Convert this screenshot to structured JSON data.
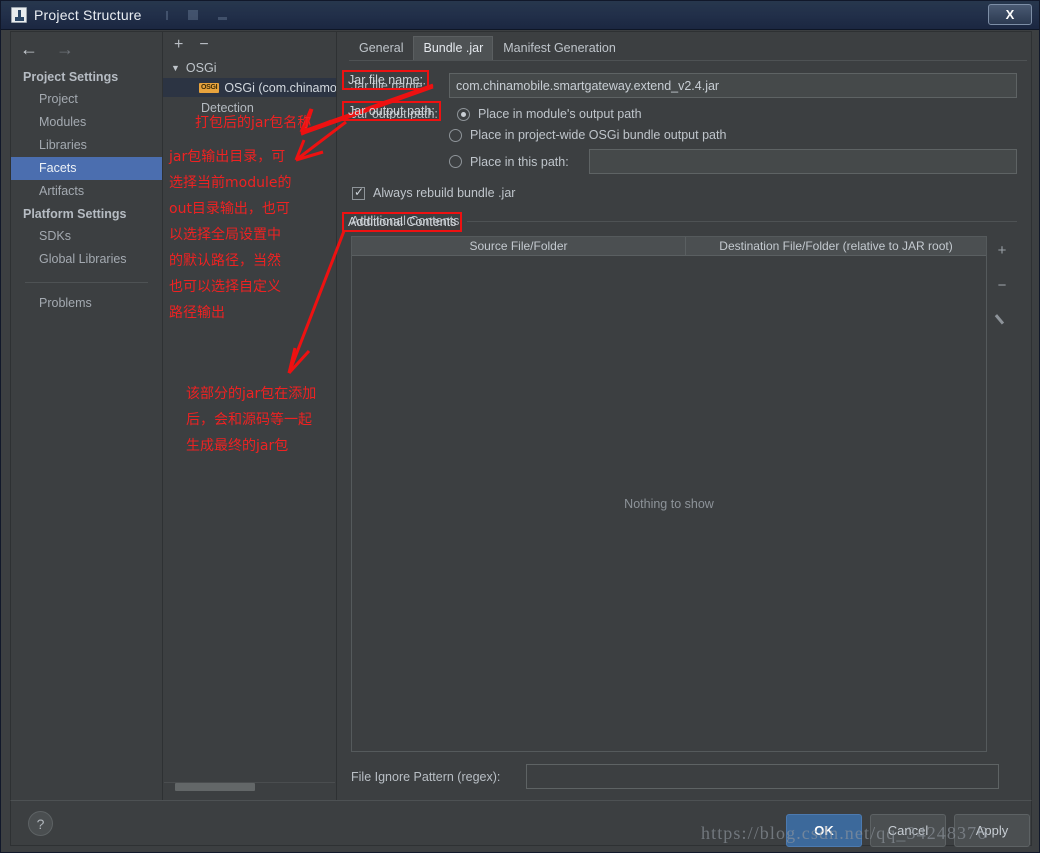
{
  "window": {
    "title": "Project Structure",
    "close_label": "X",
    "app_icon": "intellij-idea-icon"
  },
  "sidebar": {
    "nav": {
      "back": "←",
      "forward": "→"
    },
    "groups": [
      {
        "title": "Project Settings",
        "items": [
          {
            "label": "Project",
            "selected": false
          },
          {
            "label": "Modules",
            "selected": false
          },
          {
            "label": "Libraries",
            "selected": false
          },
          {
            "label": "Facets",
            "selected": true
          },
          {
            "label": "Artifacts",
            "selected": false
          }
        ]
      },
      {
        "title": "Platform Settings",
        "items": [
          {
            "label": "SDKs",
            "selected": false
          },
          {
            "label": "Global Libraries",
            "selected": false
          }
        ]
      }
    ],
    "extra_items": [
      {
        "label": "Problems"
      }
    ]
  },
  "tree": {
    "toolbar": {
      "add": "+",
      "remove": "−"
    },
    "root": {
      "label": "OSGi",
      "expander": "▼"
    },
    "child": {
      "badge": "OSGI",
      "label": "OSGi (com.chinamol"
    },
    "detection_label": "Detection"
  },
  "tabs": [
    {
      "label": "General",
      "active": false
    },
    {
      "label": "Bundle .jar",
      "active": true
    },
    {
      "label": "Manifest Generation",
      "active": false
    }
  ],
  "form": {
    "jar_file_name_label": "Jar file name:",
    "jar_file_name_value": "com.chinamobile.smartgateway.extend_v2.4.jar",
    "jar_output_path_label": "Jar output path:",
    "radios": [
      {
        "label": "Place in module's output path",
        "selected": true
      },
      {
        "label": "Place in project-wide OSGi bundle output path",
        "selected": false
      },
      {
        "label": "Place in this path:",
        "selected": false
      }
    ],
    "place_in_path_value": "",
    "browse_icon": "folder-icon",
    "always_rebuild_label": "Always rebuild bundle .jar",
    "always_rebuild_checked": true,
    "additional_contents_label": "Additional Contents",
    "table": {
      "columns": [
        "Source File/Folder",
        "Destination File/Folder (relative to JAR root)"
      ],
      "rows": [],
      "empty_message": "Nothing to show"
    },
    "table_actions": {
      "add": "+",
      "remove": "−",
      "edit": "pencil-icon"
    },
    "file_ignore_label": "File Ignore Pattern (regex):",
    "file_ignore_value": ""
  },
  "footer": {
    "help_label": "?",
    "ok_label": "OK",
    "cancel_label": "Cancel",
    "apply_label": "Apply"
  },
  "watermark": "https://blog.csdn.net/qq_34248376",
  "annotations": {
    "boxes": [
      {
        "id": "jar-file-name",
        "text": "Jar file name:"
      },
      {
        "id": "jar-output-path",
        "text": "Jar output path:"
      },
      {
        "id": "additional-contents",
        "text": "Additional Contents"
      }
    ],
    "notes": [
      {
        "id": "note-jar-name",
        "lines": [
          "打包后的jar包名称"
        ]
      },
      {
        "id": "note-output-path",
        "lines": [
          "jar包输出目录，可",
          "选择当前module的",
          "out目录输出，也可",
          "以选择全局设置中",
          "的默认路径，当然",
          "也可以选择自定义",
          "路径输出"
        ]
      },
      {
        "id": "note-additional",
        "lines": [
          "该部分的jar包在添加",
          "后，会和源码等一起",
          "生成最终的jar包"
        ]
      }
    ]
  },
  "colors": {
    "accent_selection": "#4b6eaf",
    "annotation_red": "#ee2222",
    "panel_bg": "#3c3f41",
    "titlebar": "#22304a",
    "ok_button": "#3c699b"
  }
}
